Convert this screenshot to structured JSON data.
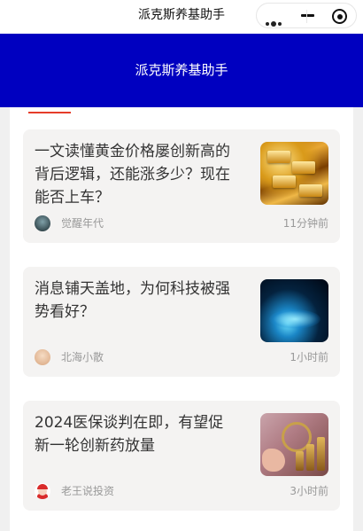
{
  "window": {
    "title": "派克斯养基助手",
    "capsule": {
      "more_icon": "more-dots-icon",
      "minimize_icon": "minimize-icon",
      "close_icon": "target-close-icon"
    }
  },
  "header": {
    "title": "派克斯养基助手",
    "background": "#0000c0"
  },
  "accent_color": "#e53c2a",
  "articles": [
    {
      "headline": "一文读懂黄金价格屡创新高的背后逻辑，还能涨多少？现在能否上车？",
      "author": "觉醒年代",
      "time": "11分钟前",
      "thumbnail": "gold-bars-image"
    },
    {
      "headline": "消息铺天盖地，为何科技被强势看好？",
      "author": "北海小散",
      "time": "1小时前",
      "thumbnail": "tech-globe-image"
    },
    {
      "headline": "2024医保谈判在即，有望促新一轮创新药放量",
      "author": "老王说投资",
      "time": "3小时前",
      "thumbnail": "coins-magnifier-image"
    }
  ]
}
